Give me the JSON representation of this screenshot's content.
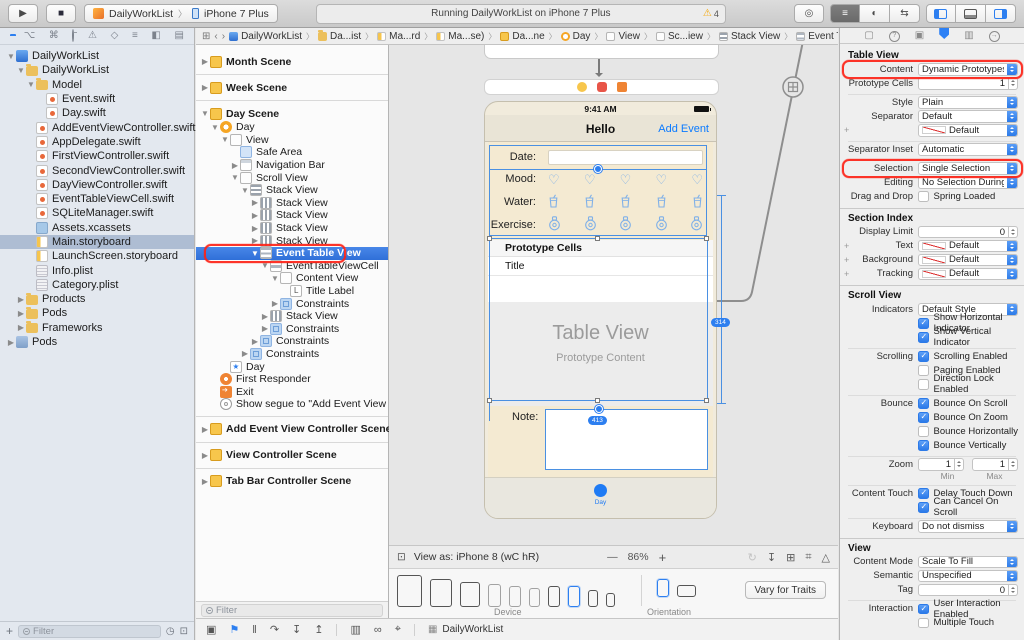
{
  "toolbar": {
    "play_icon": "play-icon",
    "stop_icon": "stop-icon",
    "scheme_app": "DailyWorkList",
    "scheme_device": "iPhone 7 Plus",
    "scheme_sep": "〉",
    "status_text": "Running DailyWorkList on iPhone 7 Plus",
    "warning_count": "4",
    "circle_button_icon": "circle-button-icon",
    "editor_modes": [
      "standard-editor-icon",
      "assistant-editor-icon",
      "version-editor-icon"
    ],
    "selected_editor": 0,
    "panel_toggles": [
      "navigator-panel-icon",
      "debug-panel-icon",
      "inspector-panel-icon"
    ],
    "active_panels": [
      0,
      2
    ]
  },
  "navigator": {
    "toolbar_icons": [
      "project-navigator-icon",
      "source-control-navigator-icon",
      "symbol-navigator-icon",
      "find-navigator-icon",
      "issue-navigator-icon",
      "test-navigator-icon",
      "debug-navigator-icon",
      "breakpoint-navigator-icon",
      "report-navigator-icon"
    ],
    "selected_toolbar_index": 0,
    "files": [
      {
        "label": "DailyWorkList",
        "depth": 0,
        "icon": "project-icon",
        "arrow": "down"
      },
      {
        "label": "DailyWorkList",
        "depth": 1,
        "icon": "folder-icon",
        "arrow": "down"
      },
      {
        "label": "Model",
        "depth": 2,
        "icon": "folder-icon",
        "arrow": "down"
      },
      {
        "label": "Event.swift",
        "depth": 3,
        "icon": "swift-file-icon"
      },
      {
        "label": "Day.swift",
        "depth": 3,
        "icon": "swift-file-icon"
      },
      {
        "label": "AddEventViewController.swift",
        "depth": 2,
        "icon": "swift-file-icon"
      },
      {
        "label": "AppDelegate.swift",
        "depth": 2,
        "icon": "swift-file-icon"
      },
      {
        "label": "FirstViewController.swift",
        "depth": 2,
        "icon": "swift-file-icon"
      },
      {
        "label": "SecondViewController.swift",
        "depth": 2,
        "icon": "swift-file-icon"
      },
      {
        "label": "DayViewController.swift",
        "depth": 2,
        "icon": "swift-file-icon"
      },
      {
        "label": "EventTableViewCell.swift",
        "depth": 2,
        "icon": "swift-file-icon"
      },
      {
        "label": "SQLiteManager.swift",
        "depth": 2,
        "icon": "swift-file-icon"
      },
      {
        "label": "Assets.xcassets",
        "depth": 2,
        "icon": "assets-icon"
      },
      {
        "label": "Main.storyboard",
        "depth": 2,
        "icon": "storyboard-icon",
        "selected": true
      },
      {
        "label": "LaunchScreen.storyboard",
        "depth": 2,
        "icon": "storyboard-icon"
      },
      {
        "label": "Info.plist",
        "depth": 2,
        "icon": "plist-icon"
      },
      {
        "label": "Category.plist",
        "depth": 2,
        "icon": "plist-icon"
      },
      {
        "label": "Products",
        "depth": 1,
        "icon": "folder-icon",
        "arrow": "right"
      },
      {
        "label": "Pods",
        "depth": 1,
        "icon": "folder-icon",
        "arrow": "right"
      },
      {
        "label": "Frameworks",
        "depth": 1,
        "icon": "folder-icon",
        "arrow": "right"
      },
      {
        "label": "Pods",
        "depth": 0,
        "icon": "pods-project-icon",
        "arrow": "right"
      }
    ],
    "add_button": "+",
    "filter_placeholder": "Filter"
  },
  "jumpbar": {
    "related_icon": "related-items-icon",
    "back": "‹",
    "forward": "›",
    "crumbs": [
      {
        "label": "DailyWorkList",
        "icon": "project-icon"
      },
      {
        "label": "Da...ist",
        "icon": "folder-icon"
      },
      {
        "label": "Ma...rd",
        "icon": "storyboard-icon"
      },
      {
        "label": "Ma...se)",
        "icon": "storyboard-icon"
      },
      {
        "label": "Da...ne",
        "icon": "scene-icon"
      },
      {
        "label": "Day",
        "icon": "vc-icon"
      },
      {
        "label": "View",
        "icon": "view-icon"
      },
      {
        "label": "Sc...iew",
        "icon": "view-icon"
      },
      {
        "label": "Stack View",
        "icon": "vstack-icon"
      },
      {
        "label": "Event Table View",
        "icon": "table-icon"
      }
    ],
    "issue_back": "‹",
    "issue_warn": "⚠",
    "issue_fwd": "›"
  },
  "outline": {
    "items": [
      {
        "label": "Month Scene",
        "depth": 0,
        "icon": "scene-icon",
        "arrow": "right",
        "top": true
      },
      {
        "label": "Week Scene",
        "depth": 0,
        "icon": "scene-icon",
        "arrow": "right",
        "top": true,
        "sep": true
      },
      {
        "label": "Day Scene",
        "depth": 0,
        "icon": "scene-icon",
        "arrow": "down",
        "top": true,
        "sep": true
      },
      {
        "label": "Day",
        "depth": 1,
        "icon": "vc-icon",
        "arrow": "down"
      },
      {
        "label": "View",
        "depth": 2,
        "icon": "view-icon",
        "arrow": "down"
      },
      {
        "label": "Safe Area",
        "depth": 3,
        "icon": "safearea-icon"
      },
      {
        "label": "Navigation Bar",
        "depth": 3,
        "icon": "navbar-icon",
        "arrow": "right"
      },
      {
        "label": "Scroll View",
        "depth": 3,
        "icon": "view-icon",
        "arrow": "down"
      },
      {
        "label": "Stack View",
        "depth": 4,
        "icon": "vstack-icon",
        "arrow": "down"
      },
      {
        "label": "Stack View",
        "depth": 5,
        "icon": "hstack-icon",
        "arrow": "right"
      },
      {
        "label": "Stack View",
        "depth": 5,
        "icon": "hstack-icon",
        "arrow": "right"
      },
      {
        "label": "Stack View",
        "depth": 5,
        "icon": "hstack-icon",
        "arrow": "right"
      },
      {
        "label": "Stack View",
        "depth": 5,
        "icon": "hstack-icon",
        "arrow": "right"
      },
      {
        "label": "Event Table View",
        "depth": 5,
        "icon": "table-icon",
        "arrow": "down",
        "selected": true,
        "annotated": true
      },
      {
        "label": "EventTableViewCell",
        "depth": 6,
        "icon": "cell-icon",
        "arrow": "down"
      },
      {
        "label": "Content View",
        "depth": 7,
        "icon": "view-icon",
        "arrow": "down"
      },
      {
        "label": "Title Label",
        "depth": 8,
        "icon": "label-icon"
      },
      {
        "label": "Constraints",
        "depth": 7,
        "icon": "constraints-icon",
        "arrow": "right"
      },
      {
        "label": "Stack View",
        "depth": 6,
        "icon": "hstack-icon",
        "arrow": "right"
      },
      {
        "label": "Constraints",
        "depth": 6,
        "icon": "constraints-icon",
        "arrow": "right"
      },
      {
        "label": "Constraints",
        "depth": 5,
        "icon": "constraints-icon",
        "arrow": "right"
      },
      {
        "label": "Constraints",
        "depth": 4,
        "icon": "constraints-icon",
        "arrow": "right"
      },
      {
        "label": "Day",
        "depth": 2,
        "icon": "tabitem-icon"
      },
      {
        "label": "First Responder",
        "depth": 1,
        "icon": "firstresponder-icon"
      },
      {
        "label": "Exit",
        "depth": 1,
        "icon": "exit-icon"
      },
      {
        "label": "Show segue to \"Add Event View C...",
        "depth": 1,
        "icon": "segue-icon"
      },
      {
        "label": "Add Event View Controller Scene",
        "depth": 0,
        "icon": "scene-icon",
        "arrow": "right",
        "top": true,
        "sep": true
      },
      {
        "label": "View Controller Scene",
        "depth": 0,
        "icon": "scene-icon",
        "arrow": "right",
        "top": true,
        "sep": true
      },
      {
        "label": "Tab Bar Controller Scene",
        "depth": 0,
        "icon": "scene-icon",
        "arrow": "right",
        "top": true,
        "sep": true
      }
    ],
    "filter_placeholder": "Filter"
  },
  "canvas": {
    "dock_icons": [
      "view-controller-dock-icon",
      "first-responder-dock-icon",
      "exit-dock-icon"
    ],
    "status_time": "9:41 AM",
    "nav_title": "Hello",
    "nav_action": "Add Event",
    "form_rows": [
      {
        "label": "Date:",
        "type": "field"
      },
      {
        "label": "Mood:",
        "type": "icons",
        "icon": "heart-icon",
        "count": 5
      },
      {
        "label": "Water:",
        "type": "icons",
        "icon": "water-cup-icon",
        "count": 5
      },
      {
        "label": "Exercise:",
        "type": "icons",
        "icon": "exercise-icon",
        "count": 5
      }
    ],
    "table": {
      "header": "Prototype Cells",
      "cell": "Title",
      "placeholder_title": "Table View",
      "placeholder_subtitle": "Prototype Content"
    },
    "note_label": "Note:",
    "tab_label": "Day",
    "badge_table": "314",
    "badge_note": "413",
    "segue_icon": "relationship-segue-icon"
  },
  "canvas_bar": {
    "grid_icon": "device-config-icon",
    "view_as": "View as: iPhone 8 (wC hR)",
    "zoom_out": "—",
    "zoom_level": "86%",
    "zoom_in": "+",
    "right_icons": [
      "update-frames-icon",
      "embed-in-stack-icon",
      "align-icon",
      "pin-icon",
      "resolve-autolayout-icon"
    ]
  },
  "device_bar": {
    "devices": [
      {
        "kind": "tablet"
      },
      {
        "kind": "tablet"
      },
      {
        "kind": "tablet"
      },
      {
        "kind": "phone"
      },
      {
        "kind": "phone"
      },
      {
        "kind": "phone"
      },
      {
        "kind": "phone"
      },
      {
        "kind": "phone",
        "selected": true
      },
      {
        "kind": "phone"
      },
      {
        "kind": "phone"
      }
    ],
    "device_label": "Device",
    "orientation_label": "Orientation",
    "vary_button": "Vary for Traits"
  },
  "debug_bar": {
    "icons": [
      "hide-debug-area-icon",
      "breakpoints-icon",
      "pause-icon",
      "step-over-icon",
      "step-into-icon",
      "step-out-icon",
      "divider",
      "debug-view-hierarchy-icon",
      "memory-graph-icon",
      "simulate-location-icon",
      "divider"
    ],
    "process_icon": "process-grid-icon",
    "process": "DailyWorkList"
  },
  "inspector": {
    "tabs": [
      "file-inspector-icon",
      "quick-help-inspector-icon",
      "identity-inspector-icon",
      "attributes-inspector-icon",
      "size-inspector-icon",
      "connections-inspector-icon"
    ],
    "selected_tab_index": 3,
    "sections": [
      {
        "title": "Table View",
        "rows": [
          {
            "t": "select",
            "label": "Content",
            "value": "Dynamic Prototypes",
            "annotated": true
          },
          {
            "t": "stepper",
            "label": "Prototype Cells",
            "value": "1"
          },
          {
            "t": "sep"
          },
          {
            "t": "select",
            "label": "Style",
            "value": "Plain"
          },
          {
            "t": "select",
            "label": "Separator",
            "value": "Default"
          },
          {
            "t": "select",
            "label": "",
            "value": "Default",
            "swatch": true,
            "plus": true
          },
          {
            "t": "sep"
          },
          {
            "t": "select",
            "label": "Separator Inset",
            "value": "Automatic"
          },
          {
            "t": "sep"
          },
          {
            "t": "select",
            "label": "Selection",
            "value": "Single Selection",
            "annotated": true
          },
          {
            "t": "select",
            "label": "Editing",
            "value": "No Selection During Editing"
          },
          {
            "t": "check",
            "label": "Drag and Drop",
            "value": "Spring Loaded",
            "checked": false
          }
        ]
      },
      {
        "title": "Section Index",
        "rows": [
          {
            "t": "stepper",
            "label": "Display Limit",
            "value": "0"
          },
          {
            "t": "select",
            "label": "Text",
            "value": "Default",
            "swatch": true,
            "plus": true
          },
          {
            "t": "select",
            "label": "Background",
            "value": "Default",
            "swatch": true,
            "plus": true
          },
          {
            "t": "select",
            "label": "Tracking",
            "value": "Default",
            "swatch": true,
            "plus": true
          }
        ]
      },
      {
        "title": "Scroll View",
        "rows": [
          {
            "t": "select",
            "label": "Indicators",
            "value": "Default Style"
          },
          {
            "t": "check",
            "label": "",
            "value": "Show Horizontal Indicator",
            "checked": true
          },
          {
            "t": "check",
            "label": "",
            "value": "Show Vertical Indicator",
            "checked": true
          },
          {
            "t": "sep"
          },
          {
            "t": "check",
            "label": "Scrolling",
            "value": "Scrolling Enabled",
            "checked": true
          },
          {
            "t": "check",
            "label": "",
            "value": "Paging Enabled",
            "checked": false
          },
          {
            "t": "check",
            "label": "",
            "value": "Direction Lock Enabled",
            "checked": false
          },
          {
            "t": "sep"
          },
          {
            "t": "check",
            "label": "Bounce",
            "value": "Bounce On Scroll",
            "checked": true
          },
          {
            "t": "check",
            "label": "",
            "value": "Bounce On Zoom",
            "checked": true
          },
          {
            "t": "check",
            "label": "",
            "value": "Bounce Horizontally",
            "checked": false
          },
          {
            "t": "check",
            "label": "",
            "value": "Bounce Vertically",
            "checked": true
          },
          {
            "t": "sep"
          },
          {
            "t": "zoom2",
            "label": "Zoom",
            "v1": "1",
            "sub1": "Min",
            "v2": "1",
            "sub2": "Max"
          },
          {
            "t": "sep"
          },
          {
            "t": "check",
            "label": "Content Touch",
            "value": "Delay Touch Down",
            "checked": true
          },
          {
            "t": "check",
            "label": "",
            "value": "Can Cancel On Scroll",
            "checked": true
          },
          {
            "t": "sep"
          },
          {
            "t": "select",
            "label": "Keyboard",
            "value": "Do not dismiss"
          }
        ]
      },
      {
        "title": "View",
        "rows": [
          {
            "t": "select",
            "label": "Content Mode",
            "value": "Scale To Fill"
          },
          {
            "t": "select",
            "label": "Semantic",
            "value": "Unspecified"
          },
          {
            "t": "stepper",
            "label": "Tag",
            "value": "0"
          },
          {
            "t": "sep"
          },
          {
            "t": "check",
            "label": "Interaction",
            "value": "User Interaction Enabled",
            "checked": true
          },
          {
            "t": "check",
            "label": "",
            "value": "Multiple Touch",
            "checked": false
          }
        ]
      }
    ]
  }
}
